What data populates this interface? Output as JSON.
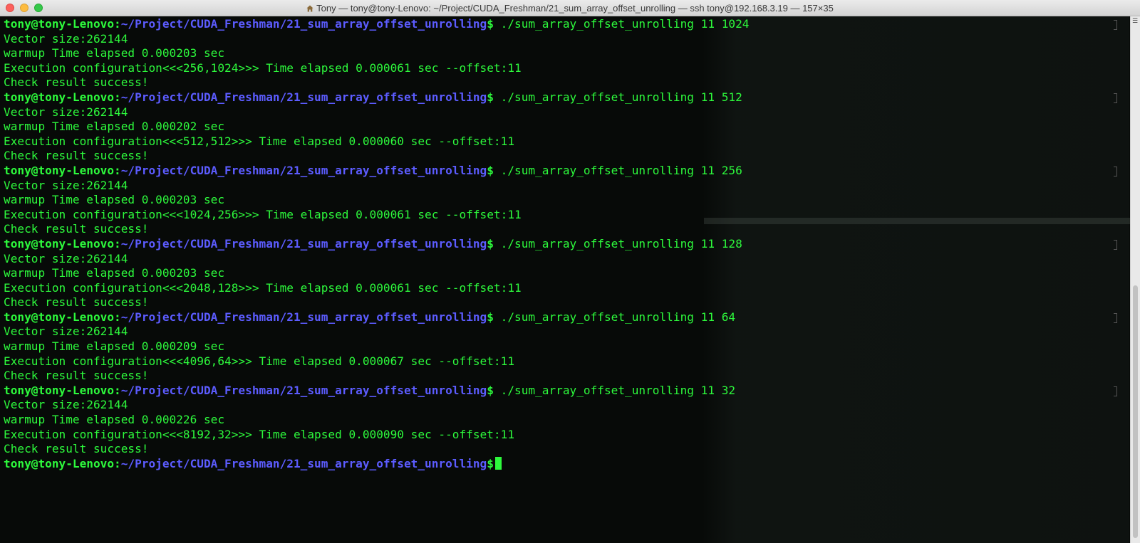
{
  "window": {
    "title": "Tony — tony@tony-Lenovo: ~/Project/CUDA_Freshman/21_sum_array_offset_unrolling — ssh tony@192.168.3.19 — 157×35"
  },
  "colors": {
    "output": "#2df93c",
    "prompt_user": "#2df93c",
    "prompt_path": "#5c5cff",
    "background": "#070a08"
  },
  "terminal": {
    "prompt_user": "tony@tony-Lenovo:",
    "prompt_path": "~/Project/CUDA_Freshman/21_sum_array_offset_unrolling",
    "prompt_symbol": "$",
    "runs": [
      {
        "command": " ./sum_array_offset_unrolling 11 1024",
        "vector": "Vector size:262144",
        "warmup": "warmup Time elapsed 0.000203 sec",
        "exec": "Execution configuration<<<256,1024>>> Time elapsed 0.000061 sec --offset:11",
        "check": "Check result success!"
      },
      {
        "command": " ./sum_array_offset_unrolling 11 512",
        "vector": "Vector size:262144",
        "warmup": "warmup Time elapsed 0.000202 sec",
        "exec": "Execution configuration<<<512,512>>> Time elapsed 0.000060 sec --offset:11",
        "check": "Check result success!"
      },
      {
        "command": " ./sum_array_offset_unrolling 11 256",
        "vector": "Vector size:262144",
        "warmup": "warmup Time elapsed 0.000203 sec",
        "exec": "Execution configuration<<<1024,256>>> Time elapsed 0.000061 sec --offset:11",
        "check": "Check result success!"
      },
      {
        "command": " ./sum_array_offset_unrolling 11 128",
        "vector": "Vector size:262144",
        "warmup": "warmup Time elapsed 0.000203 sec",
        "exec": "Execution configuration<<<2048,128>>> Time elapsed 0.000061 sec --offset:11",
        "check": "Check result success!"
      },
      {
        "command": " ./sum_array_offset_unrolling 11 64",
        "vector": "Vector size:262144",
        "warmup": "warmup Time elapsed 0.000209 sec",
        "exec": "Execution configuration<<<4096,64>>> Time elapsed 0.000067 sec --offset:11",
        "check": "Check result success!"
      },
      {
        "command": " ./sum_array_offset_unrolling 11 32",
        "vector": "Vector size:262144",
        "warmup": "warmup Time elapsed 0.000226 sec",
        "exec": "Execution configuration<<<8192,32>>> Time elapsed 0.000090 sec --offset:11",
        "check": "Check result success!"
      }
    ]
  }
}
